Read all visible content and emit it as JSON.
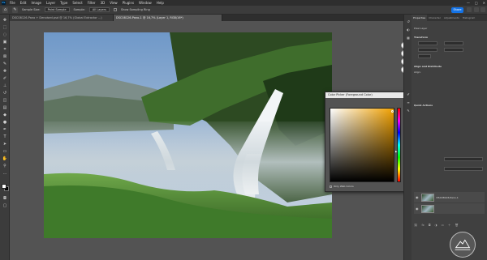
{
  "menubar": {
    "items": [
      "File",
      "Edit",
      "Image",
      "Layer",
      "Type",
      "Select",
      "Filter",
      "3D",
      "View",
      "Plugins",
      "Window",
      "Help"
    ]
  },
  "options": {
    "sample_size_label": "Sample Size:",
    "sample_size_value": "Point Sample",
    "sample_label": "Sample:",
    "sample_value": "All Layers",
    "show_ring_label": "Show Sampling Ring",
    "share_label": "Share"
  },
  "tabs": [
    {
      "label": "DSC08126-Pano + Denoised.psd @ 16,7% (Global Extractor ...)",
      "active": false
    },
    {
      "label": "DSC08126-Pano-1 @ 16,7% (Layer 1, RGB/16*)",
      "active": true
    }
  ],
  "panels": {
    "tabs": [
      "Properties",
      "Character",
      "Adjustments",
      "Histogram"
    ],
    "pixel_layer": "Pixel Layer",
    "transform_label": "Transform",
    "align_label": "Align and Distribute",
    "align_sub": "Align:",
    "quick_actions_label": "Quick Actions",
    "layer_name": "DSC08126-Pano-1"
  },
  "color_picker": {
    "title": "Color Picker (Foreground Color)",
    "new_label": "new",
    "current_label": "current",
    "ok_label": "OK",
    "cancel_label": "Cancel",
    "add_swatches_label": "Add to Swatches",
    "color_libraries_label": "Color Libraries",
    "only_web_colors_label": "Only Web Colors",
    "hsb": [
      {
        "label": "H:",
        "value": "0",
        "unit": "°"
      },
      {
        "label": "S:",
        "value": "0",
        "unit": "%"
      },
      {
        "label": "B:",
        "value": "100",
        "unit": "%"
      }
    ],
    "rgb": [
      {
        "label": "R:",
        "value": "255"
      },
      {
        "label": "G:",
        "value": "255"
      },
      {
        "label": "B:",
        "value": "255"
      }
    ],
    "lab": [
      {
        "label": "L:",
        "value": "100"
      },
      {
        "label": "a:",
        "value": "0"
      },
      {
        "label": "b:",
        "value": "0"
      }
    ],
    "cmyk": [
      {
        "label": "C:",
        "value": "0",
        "unit": "%"
      },
      {
        "label": "M:",
        "value": "0",
        "unit": "%"
      },
      {
        "label": "Y:",
        "value": "0",
        "unit": "%"
      },
      {
        "label": "K:",
        "value": "0",
        "unit": "%"
      }
    ],
    "hex_label": "#",
    "hex_value": "ffffff",
    "new_color": "#ffffff",
    "current_color": "#000000"
  },
  "colors": {
    "accent": "#1473e6",
    "foreground": "#ffffff",
    "background": "#000000"
  },
  "icons": [
    "move-icon",
    "marquee-icon",
    "lasso-icon",
    "object-select-icon",
    "crop-icon",
    "frame-icon",
    "eyedropper-icon",
    "healing-icon",
    "brush-icon",
    "stamp-icon",
    "history-brush-icon",
    "eraser-icon",
    "gradient-icon",
    "blur-icon",
    "dodge-icon",
    "pen-icon",
    "type-icon",
    "path-select-icon",
    "rectangle-icon",
    "hand-icon",
    "zoom-icon"
  ]
}
